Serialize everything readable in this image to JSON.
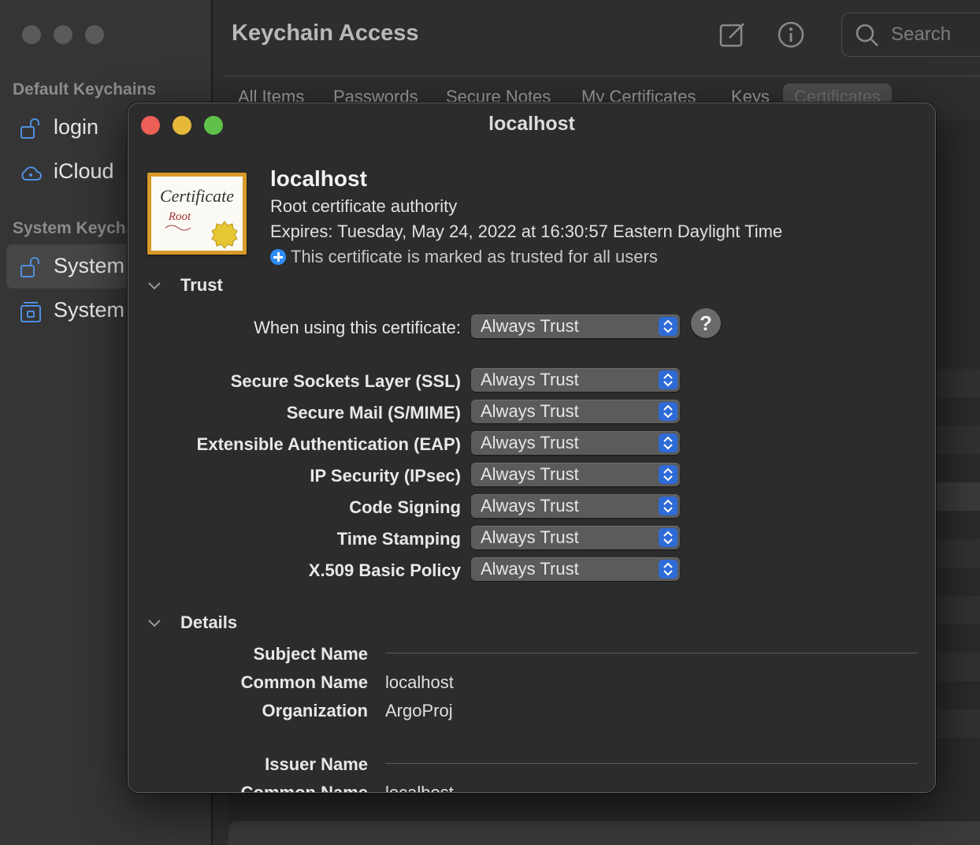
{
  "background_window": {
    "title": "Keychain Access",
    "search_placeholder": "Search",
    "sidebar": {
      "default_heading": "Default Keychains",
      "default_items": [
        {
          "label": "login",
          "icon": "lock-open-icon"
        },
        {
          "label": "iCloud",
          "icon": "cloud-icon"
        }
      ],
      "system_heading": "System Keychains",
      "system_items": [
        {
          "label": "System",
          "icon": "lock-open-icon",
          "selected": true
        },
        {
          "label": "System Roots",
          "icon": "cabinet-icon"
        }
      ]
    },
    "tabs": [
      "All Items",
      "Passwords",
      "Secure Notes",
      "My Certificates",
      "Keys",
      "Certificates"
    ],
    "active_tab": "Certificates"
  },
  "sheet": {
    "window_title": "localhost",
    "cert": {
      "name": "localhost",
      "type": "Root certificate authority",
      "expires": "Expires: Tuesday, May 24, 2022 at 16:30:57 Eastern Daylight Time",
      "trust_status": "This certificate is marked as trusted for all users",
      "icon_text_1": "Certificate",
      "icon_text_2": "Root"
    },
    "trust": {
      "heading": "Trust",
      "when_using_label": "When using this certificate:",
      "when_using_value": "Always Trust",
      "help": "?",
      "policies": [
        {
          "label": "Secure Sockets Layer (SSL)",
          "value": "Always Trust"
        },
        {
          "label": "Secure Mail (S/MIME)",
          "value": "Always Trust"
        },
        {
          "label": "Extensible Authentication (EAP)",
          "value": "Always Trust"
        },
        {
          "label": "IP Security (IPsec)",
          "value": "Always Trust"
        },
        {
          "label": "Code Signing",
          "value": "Always Trust"
        },
        {
          "label": "Time Stamping",
          "value": "Always Trust"
        },
        {
          "label": "X.509 Basic Policy",
          "value": "Always Trust"
        }
      ]
    },
    "details": {
      "heading": "Details",
      "subject_heading": "Subject Name",
      "subject": [
        {
          "label": "Common Name",
          "value": "localhost"
        },
        {
          "label": "Organization",
          "value": "ArgoProj"
        }
      ],
      "issuer_heading": "Issuer Name",
      "issuer": [
        {
          "label": "Common Name",
          "value": "localhost"
        }
      ]
    }
  }
}
